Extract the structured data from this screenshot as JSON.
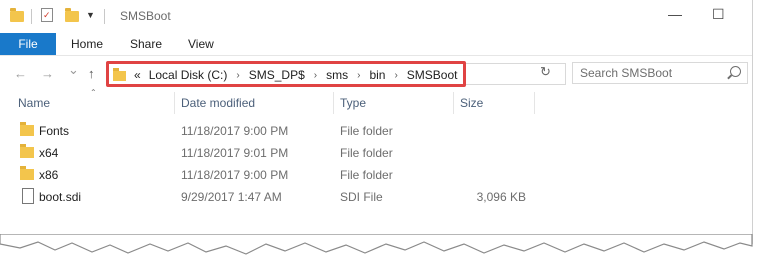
{
  "window": {
    "title": "SMSBoot"
  },
  "title_controls": {
    "minimize": "—",
    "maximize": "☐"
  },
  "ribbon": {
    "tabs": [
      "File",
      "Home",
      "Share",
      "View"
    ]
  },
  "nav": {
    "back": "←",
    "forward": "→",
    "recent": "⌄",
    "up": "↑",
    "refresh": "↻"
  },
  "address": {
    "overflow": "«",
    "crumbs": [
      "Local Disk (C:)",
      "SMS_DP$",
      "sms",
      "bin",
      "SMSBoot"
    ],
    "separator": "›"
  },
  "search": {
    "placeholder": "Search SMSBoot"
  },
  "columns": {
    "name": "Name",
    "date": "Date modified",
    "type": "Type",
    "size": "Size"
  },
  "files": [
    {
      "name": "Fonts",
      "date": "11/18/2017 9:00 PM",
      "type": "File folder",
      "size": "",
      "icon": "folder-icon"
    },
    {
      "name": "x64",
      "date": "11/18/2017 9:01 PM",
      "type": "File folder",
      "size": "",
      "icon": "folder-icon"
    },
    {
      "name": "x86",
      "date": "11/18/2017 9:00 PM",
      "type": "File folder",
      "size": "",
      "icon": "folder-icon"
    },
    {
      "name": "boot.sdi",
      "date": "9/29/2017 1:47 AM",
      "type": "SDI File",
      "size": "3,096 KB",
      "icon": "file-icon"
    }
  ],
  "colors": {
    "accent": "#1979ca",
    "highlight": "#e04343",
    "folder": "#f3c54c"
  }
}
